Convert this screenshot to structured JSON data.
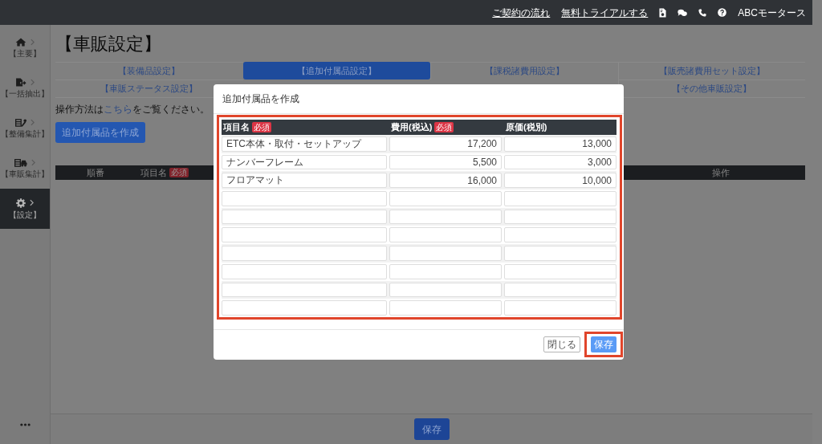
{
  "top_bar": {
    "links": [
      {
        "label": "ご契約の流れ"
      },
      {
        "label": "無料トライアルする"
      }
    ],
    "company": "ABCモータース"
  },
  "sidebar": {
    "items": [
      {
        "kind": "home",
        "label": "【主要】",
        "selected": false
      },
      {
        "kind": "export",
        "label": "【一括抽出】",
        "selected": false
      },
      {
        "kind": "maintenance",
        "label": "【整備集計】",
        "selected": false
      },
      {
        "kind": "sales",
        "label": "【車販集計】",
        "selected": false
      },
      {
        "kind": "settings",
        "label": "【設定】",
        "selected": true
      }
    ]
  },
  "page": {
    "title": "【車販設定】",
    "tabs": [
      {
        "label": "【装備品設定】",
        "selected": false
      },
      {
        "label": "【追加付属品設定】",
        "selected": true
      },
      {
        "label": "【課税諸費用設定】",
        "selected": false
      },
      {
        "label": "【販売諸費用セット設定】",
        "selected": false
      },
      {
        "label": "【車販ステータス設定】",
        "selected": false
      },
      {
        "label": "【その他車販設定】",
        "selected": false
      }
    ],
    "instruction": {
      "before": "操作方法は",
      "link": "こちら",
      "after": "をご覧ください。"
    },
    "create_button": "追加付属品を作成",
    "table": {
      "columns": [
        {
          "label": "順番"
        },
        {
          "label": "項目名",
          "badge": "必須"
        },
        {
          "label": "操作"
        }
      ]
    }
  },
  "dialog": {
    "title": "追加付属品を作成",
    "table": {
      "highlighted": true,
      "columns": [
        {
          "label": "項目名",
          "badge": "必須",
          "kind": "text"
        },
        {
          "label": "費用(税込)",
          "badge": "必須",
          "kind": "number"
        },
        {
          "label": "原価(税別)",
          "kind": "number"
        }
      ],
      "rows": [
        {
          "values": [
            "ETC本体・取付・セットアップ",
            "17,200",
            "13,000"
          ]
        },
        {
          "values": [
            "ナンバーフレーム",
            "5,500",
            "3,000"
          ]
        },
        {
          "values": [
            "フロアマット",
            "16,000",
            "10,000"
          ]
        },
        {},
        {},
        {},
        {},
        {},
        {},
        {}
      ]
    },
    "buttons": [
      {
        "label": "閉じる",
        "kind": "secondary",
        "highlighted": false
      },
      {
        "label": "保存",
        "kind": "primary",
        "highlighted": true
      }
    ]
  },
  "footer": {
    "save_button": "保存"
  }
}
